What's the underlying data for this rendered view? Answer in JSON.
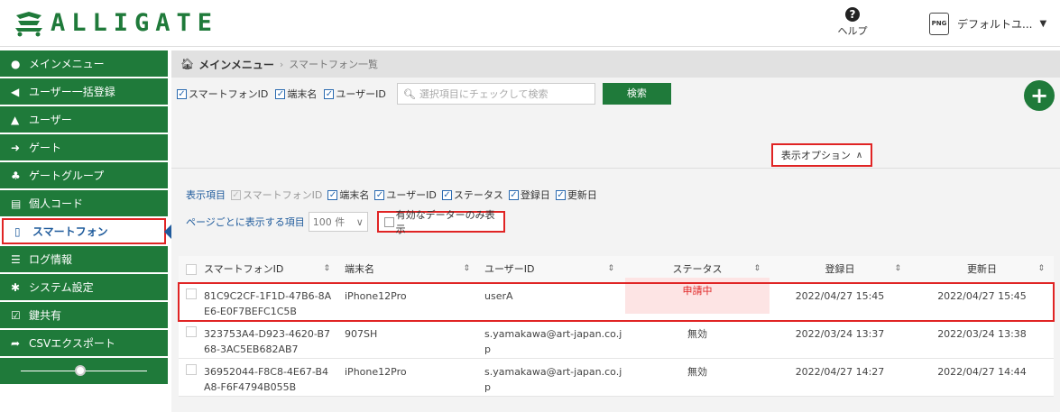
{
  "header": {
    "logo_text": "ALLIGATE",
    "help_label": "ヘルプ",
    "user_name": "デフォルトユ...",
    "png_label": "PNG"
  },
  "sidebar": {
    "items": [
      {
        "label": "メインメニュー",
        "icon": "dashboard-icon",
        "glyph": "●"
      },
      {
        "label": "ユーザー一括登録",
        "icon": "share-icon",
        "glyph": "◀"
      },
      {
        "label": "ユーザー",
        "icon": "user-icon",
        "glyph": "▲"
      },
      {
        "label": "ゲート",
        "icon": "sign-in-icon",
        "glyph": "➜"
      },
      {
        "label": "ゲートグループ",
        "icon": "users-icon",
        "glyph": "♣"
      },
      {
        "label": "個人コード",
        "icon": "card-icon",
        "glyph": "▤"
      },
      {
        "label": "スマートフォン",
        "icon": "mobile-icon",
        "glyph": "▯"
      },
      {
        "label": "ログ情報",
        "icon": "list-icon",
        "glyph": "☰"
      },
      {
        "label": "システム設定",
        "icon": "gear-icon",
        "glyph": "✱"
      },
      {
        "label": "鍵共有",
        "icon": "share-check-icon",
        "glyph": "☑"
      },
      {
        "label": "CSVエクスポート",
        "icon": "export-icon",
        "glyph": "➦"
      }
    ]
  },
  "breadcrumb": {
    "home": "メインメニュー",
    "separator": "›",
    "current": "スマートフォン一覧"
  },
  "search": {
    "checks": [
      {
        "label": "スマートフォンID",
        "checked": true
      },
      {
        "label": "端末名",
        "checked": true
      },
      {
        "label": "ユーザーID",
        "checked": true
      }
    ],
    "placeholder": "選択項目にチェックして検索",
    "button": "検索"
  },
  "add_button": "+",
  "display_option": {
    "label": "表示オプション",
    "caret": "∧"
  },
  "display_items": {
    "label": "表示項目",
    "checks": [
      {
        "label": "スマートフォンID",
        "checked": true,
        "disabled": true
      },
      {
        "label": "端末名",
        "checked": true
      },
      {
        "label": "ユーザーID",
        "checked": true
      },
      {
        "label": "ステータス",
        "checked": true
      },
      {
        "label": "登録日",
        "checked": true
      },
      {
        "label": "更新日",
        "checked": true
      }
    ]
  },
  "per_page": {
    "label": "ページごとに表示する項目",
    "value": "100 件",
    "caret": "∨"
  },
  "valid_only": {
    "label": "有効なデーターのみ表示",
    "checked": false
  },
  "table": {
    "headers": {
      "id": "スマートフォンID",
      "name": "端末名",
      "user": "ユーザーID",
      "status": "ステータス",
      "registered": "登録日",
      "updated": "更新日",
      "sort": "⇕"
    },
    "rows": [
      {
        "id_line1": "81C9C2CF-1F1D-47B6-8A",
        "id_line2": "E6-E0F7BEFC1C5B",
        "name": "iPhone12Pro",
        "user": "userA",
        "status": "申請中",
        "registered": "2022/04/27 15:45",
        "updated": "2022/04/27 15:45"
      },
      {
        "id_line1": "323753A4-D923-4620-B7",
        "id_line2": "68-3AC5EB682AB7",
        "name": "907SH",
        "user": "s.yamakawa@art-japan.co.jp",
        "status": "無効",
        "registered": "2022/03/24 13:37",
        "updated": "2022/03/24 13:38"
      },
      {
        "id_line1": "36952044-F8C8-4E67-B4",
        "id_line2": "A8-F6F4794B055B",
        "name": "iPhone12Pro",
        "user": "s.yamakawa@art-japan.co.jp",
        "status": "無効",
        "registered": "2022/04/27 14:27",
        "updated": "2022/04/27 14:44"
      }
    ]
  },
  "colors": {
    "brand_green": "#1f7a3a",
    "highlight_red": "#e02424",
    "link_blue": "#1f5b9c"
  }
}
